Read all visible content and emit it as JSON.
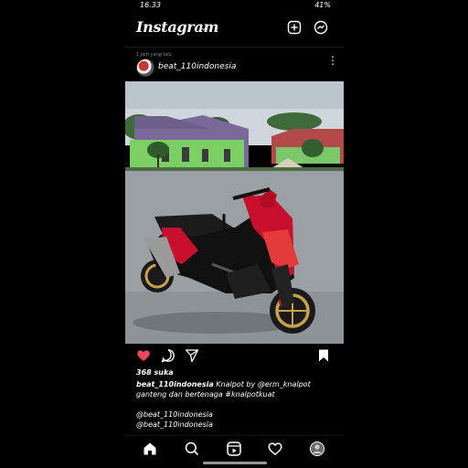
{
  "status_bar": {
    "time": "16.33",
    "right_indicators": "41%"
  },
  "header": {
    "app_name": "Instagram",
    "dropdown_glyph": "⌄",
    "sub_line": "1 jam yang lalu"
  },
  "post": {
    "username": "beat_110indonesia",
    "more_glyph": "⋮",
    "likes": "368 suka",
    "caption_user": "beat_110indonesia",
    "caption_text": " Knalpot by @erm_knalpot ganteng dan bertenaga #knalpotkuat",
    "mentions": [
      "@beat_110indonesia",
      "@beat_110indonesia"
    ]
  },
  "icons": {
    "add": "plus-square-icon",
    "messenger": "messenger-icon",
    "like": "heart-filled-icon",
    "comment": "comment-icon",
    "share": "send-icon",
    "save": "bookmark-icon",
    "nav": [
      "home-icon",
      "search-icon",
      "reels-icon",
      "heart-icon",
      "profile-avatar"
    ]
  },
  "colors": {
    "like": "#ed4956",
    "background": "#000000",
    "text": "#ffffff",
    "motorcycle": "#c8102e"
  }
}
